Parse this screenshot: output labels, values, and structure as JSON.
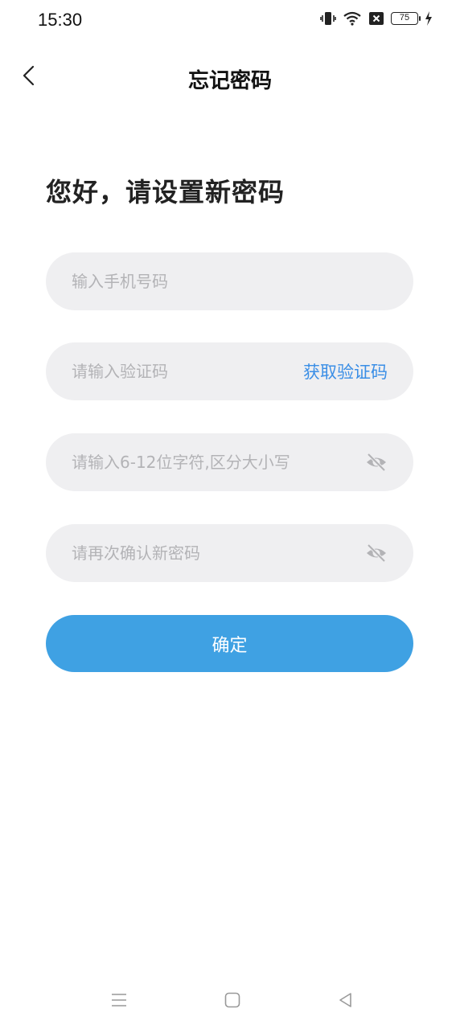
{
  "status_bar": {
    "time": "15:30",
    "battery": "75",
    "icons": [
      "vibrate-icon",
      "wifi-icon",
      "sim-error-icon",
      "battery-icon",
      "charging-icon"
    ]
  },
  "nav": {
    "title": "忘记密码",
    "back_icon": "chevron-left-icon"
  },
  "heading": "您好，请设置新密码",
  "form": {
    "phone_placeholder": "输入手机号码",
    "code_placeholder": "请输入验证码",
    "get_code_label": "获取验证码",
    "password_placeholder": "请输入6-12位字符,区分大小写",
    "confirm_password_placeholder": "请再次确认新密码",
    "submit_label": "确定"
  },
  "colors": {
    "accent": "#3fa1e3",
    "link": "#3a8ee6",
    "field_bg": "#efeff1",
    "placeholder": "#b3b3b6"
  },
  "system_nav": [
    "menu-icon",
    "home-icon",
    "back-triangle-icon"
  ]
}
